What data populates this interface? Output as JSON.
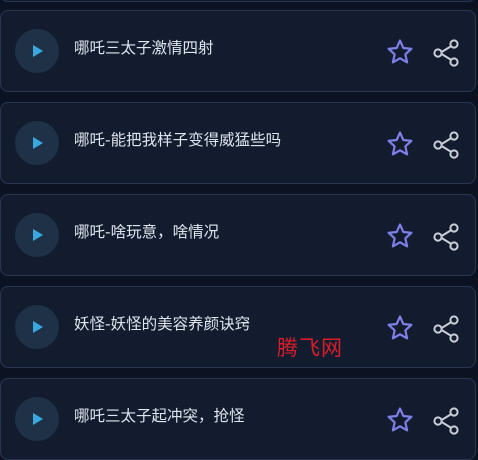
{
  "items": [
    {
      "title": ""
    },
    {
      "title": "哪吒三太子激情四射"
    },
    {
      "title": "哪吒-能把我样子变得威猛些吗"
    },
    {
      "title": "哪吒-啥玩意，啥情况"
    },
    {
      "title": "妖怪-妖怪的美容养颜诀窍"
    },
    {
      "title": "哪吒三太子起冲突，抢怪"
    }
  ],
  "icons": {
    "play": "play-icon",
    "favorite": "star-outline-icon",
    "share": "share-icon"
  },
  "watermark": "腾飞网",
  "colors": {
    "background": "#0b1323",
    "card": "#131c2e",
    "card_border": "#2a3550",
    "play_circle": "#1f3147",
    "play_triangle": "#3aa8e0",
    "star": "#7f7fe8",
    "share": "#c9ced8",
    "title_text": "#dfe5ef",
    "watermark": "#d81e2b"
  }
}
